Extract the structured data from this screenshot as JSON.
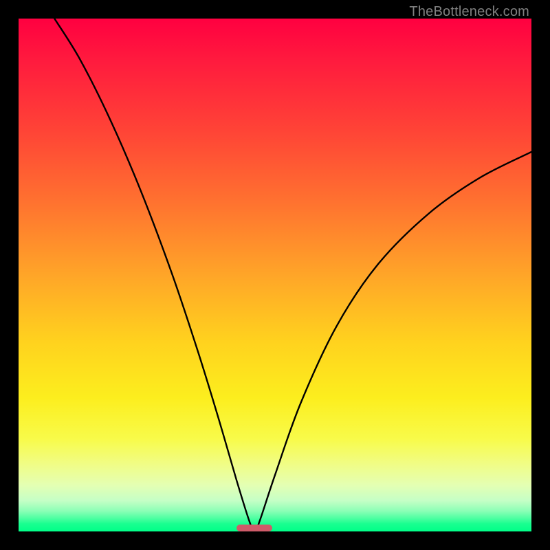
{
  "watermark": "TheBottleneck.com",
  "chart_data": {
    "type": "line",
    "title": "",
    "xlabel": "",
    "ylabel": "",
    "xlim": [
      0,
      100
    ],
    "ylim": [
      0,
      100
    ],
    "curve_minimum_x": 46,
    "curve_minimum_width_pct": 7,
    "background_gradient": {
      "top": "#ff0040",
      "mid": "#ffd21e",
      "bottom": "#00ff88"
    },
    "curve_points_percent": [
      {
        "x": 7.0,
        "y": 100.0
      },
      {
        "x": 12.0,
        "y": 92.0
      },
      {
        "x": 18.0,
        "y": 80.0
      },
      {
        "x": 24.0,
        "y": 66.0
      },
      {
        "x": 30.0,
        "y": 50.0
      },
      {
        "x": 35.0,
        "y": 35.0
      },
      {
        "x": 39.0,
        "y": 22.0
      },
      {
        "x": 42.5,
        "y": 10.0
      },
      {
        "x": 45.0,
        "y": 2.0
      },
      {
        "x": 46.0,
        "y": 0.0
      },
      {
        "x": 47.0,
        "y": 2.0
      },
      {
        "x": 50.0,
        "y": 11.0
      },
      {
        "x": 55.0,
        "y": 25.0
      },
      {
        "x": 62.0,
        "y": 40.0
      },
      {
        "x": 70.0,
        "y": 52.0
      },
      {
        "x": 80.0,
        "y": 62.0
      },
      {
        "x": 90.0,
        "y": 69.0
      },
      {
        "x": 100.0,
        "y": 74.0
      }
    ],
    "marker": {
      "center_x_pct": 46,
      "width_pct": 7,
      "color": "#cf5b69"
    }
  }
}
